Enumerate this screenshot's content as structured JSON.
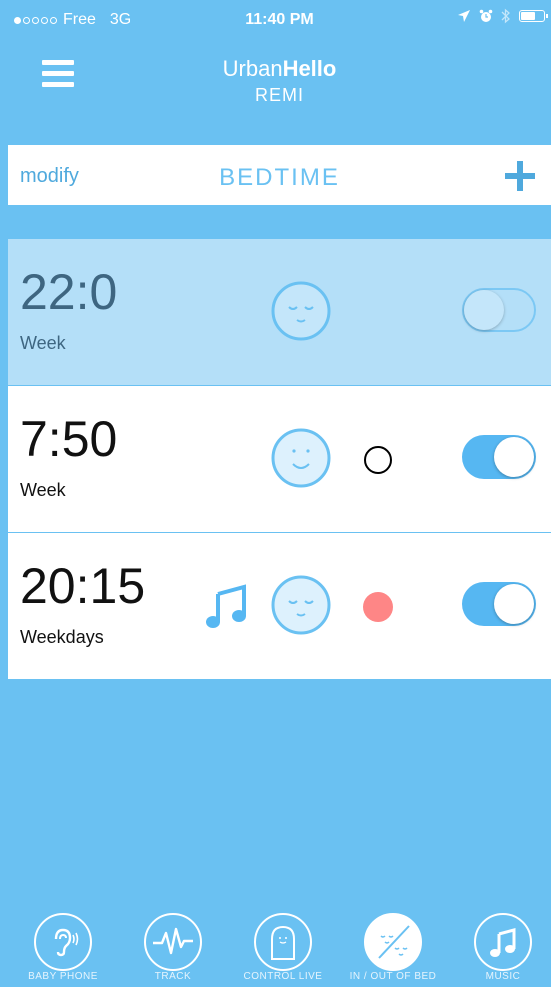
{
  "status_bar": {
    "carrier": "Free",
    "network": "3G",
    "time": "11:40 PM"
  },
  "header": {
    "brand_light": "Urban",
    "brand_bold": "Hello",
    "subtitle": "REMI"
  },
  "toolbar": {
    "modify_label": "modify",
    "title": "BEDTIME",
    "add_icon": "plus-icon"
  },
  "alarms": [
    {
      "time": "22:0",
      "label": "Week",
      "face": "sleeping-face-icon",
      "enabled": false,
      "note": false,
      "dot": "none"
    },
    {
      "time": "7:50",
      "label": "Week",
      "face": "smiling-face-icon",
      "enabled": true,
      "note": false,
      "dot": "empty-circle"
    },
    {
      "time": "20:15",
      "label": "Weekdays",
      "face": "sleeping-face-icon",
      "enabled": true,
      "note": true,
      "dot": "red-circle"
    }
  ],
  "tabs": [
    {
      "label": "BABY PHONE",
      "icon": "ear-icon",
      "active": false
    },
    {
      "label": "TRACK",
      "icon": "heartbeat-icon",
      "active": false
    },
    {
      "label": "CONTROL LIVE",
      "icon": "remi-device-icon",
      "active": false
    },
    {
      "label": "IN / OUT OF BED",
      "icon": "in-out-bed-icon",
      "active": true
    },
    {
      "label": "MUSIC",
      "icon": "music-note-icon",
      "active": false
    }
  ],
  "colors": {
    "brand_blue": "#6ac1f2",
    "accent_blue": "#4fa9dd",
    "selected_row": "#b4dff8",
    "toggle_on": "#56b7f2",
    "dot_red": "#fe8686"
  }
}
